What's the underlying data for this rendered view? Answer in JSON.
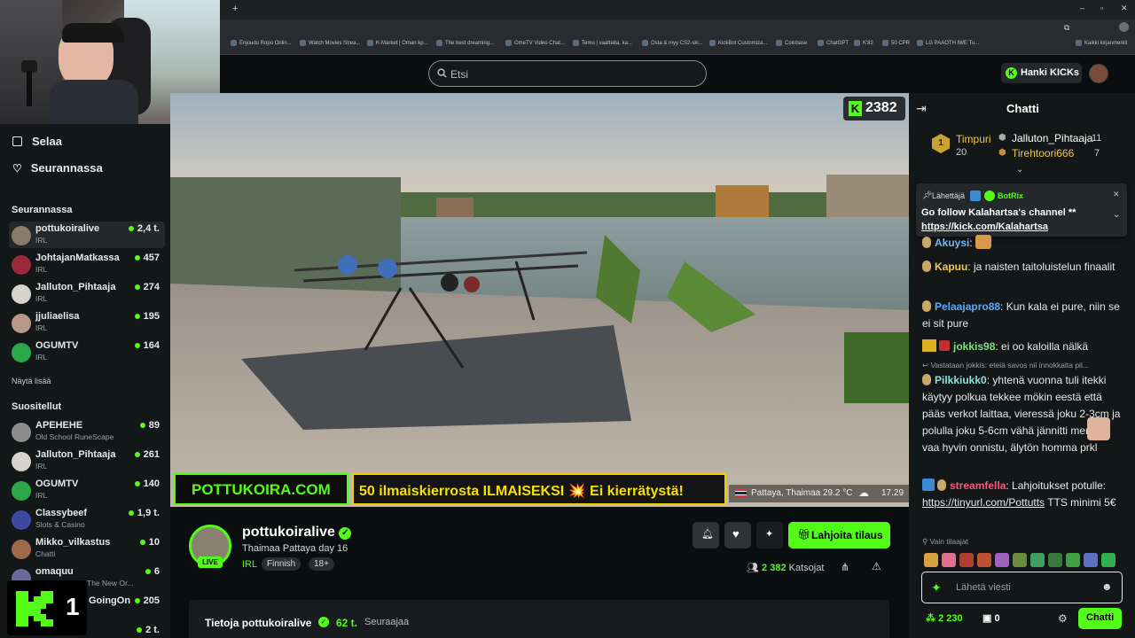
{
  "browser": {
    "bookmarks": [
      "Enjoudu Ropo Onlin...",
      "Watch Movies Strea...",
      "K-Market | Oman kp...",
      "The best dreaming...",
      "OmeTV Video Chat...",
      "Temu | vaatteita, ka...",
      "Osta & myy CS2-ski...",
      "KickBot Customiza...",
      "Coinbase",
      "ChatGPT",
      "K'82",
      "50 CPR",
      "LG PAAOTH IWE Tu...",
      "Kaikki kirjanmerkit"
    ]
  },
  "header": {
    "search_placeholder": "Etsi",
    "hanki_label": "Hanki KICKs"
  },
  "sidebar": {
    "nav": [
      {
        "label": "Selaa",
        "icon": "browse-icon"
      },
      {
        "label": "Seurannassa",
        "icon": "heart-icon"
      }
    ],
    "following_header": "Seurannassa",
    "following": [
      {
        "name": "pottukoiralive",
        "category": "IRL",
        "viewers": "2,4 t."
      },
      {
        "name": "JohtajanMatkassa",
        "category": "IRL",
        "viewers": "457"
      },
      {
        "name": "Jalluton_Pihtaaja",
        "category": "IRL",
        "viewers": "274"
      },
      {
        "name": "jjuliaelisa",
        "category": "IRL",
        "viewers": "195"
      },
      {
        "name": "OGUMTV",
        "category": "IRL",
        "viewers": "164"
      }
    ],
    "show_more": "Näytä lisää",
    "recommended_header": "Suositellut",
    "recommended": [
      {
        "name": "APEHEHE",
        "category": "Old School RuneScape",
        "viewers": "89"
      },
      {
        "name": "Jalluton_Pihtaaja",
        "category": "IRL",
        "viewers": "261"
      },
      {
        "name": "OGUMTV",
        "category": "IRL",
        "viewers": "140"
      },
      {
        "name": "Classybeef",
        "category": "Slots & Casino",
        "viewers": "1,9 t."
      },
      {
        "name": "Mikko_vilkastus",
        "category": "Chatti",
        "viewers": "10"
      },
      {
        "name": "omaquu",
        "category": "The New Or...",
        "viewers": "6"
      },
      {
        "name": "GoingOn",
        "category": "",
        "viewers": "205"
      },
      {
        "name": "",
        "category": "",
        "viewers": "2 t."
      }
    ],
    "overlay_number": "1"
  },
  "video": {
    "viewer_badge": "2382",
    "banner_site": "POTTUKOIRA.COM",
    "banner_promo": "50 ilmaiskierrosta ILMAISEKSI 💥 Ei kierrätystä!",
    "location": "Pattaya, Thaimaa",
    "temperature": "29.2 °C",
    "time": "17.29"
  },
  "stream": {
    "channel": "pottukoiralive",
    "live_label": "LIVE",
    "title": "Thaimaa Pattaya day 16",
    "tags": [
      "IRL",
      "Finnish",
      "18+"
    ],
    "gift_sub_label": "Lahjoita tilaus",
    "viewers": "2 382",
    "viewers_suffix": "Katsojat",
    "about_prefix": "Tietoja pottukoiralive",
    "followers": "62 t.",
    "followers_suffix": "Seuraajaa"
  },
  "chat": {
    "title": "Chatti",
    "leaderboard": [
      {
        "rank": "1",
        "name": "Timpuri",
        "count": "20"
      },
      {
        "name": "Jalluton_Pihtaaja",
        "count": "11"
      },
      {
        "name": "Tirehtoori666",
        "count": "7"
      }
    ],
    "pinned": {
      "label": "Lähettäjä",
      "sender": "BotRix",
      "text": "Go follow Kalahartsa's channel **",
      "link": "https://kick.com/Kalahartsa"
    },
    "messages": [
      {
        "user": "Akuysi",
        "text": "",
        "color": "#6fb6f2"
      },
      {
        "user": "Kapuu",
        "text": "ja naisten taitoluistelun finaalit",
        "color": "#f2c94c"
      },
      {
        "user": "Pelaajapro88",
        "text": "Kun kala ei pure, niin se ei sit pure",
        "color": "#5aa9f5"
      },
      {
        "user": "jokkis98",
        "text": "ei oo kaloilla nälkä",
        "color": "#7be37b"
      },
      {
        "user": "Pilkkiukk0",
        "reply": "Vastataan jokkis: eteiä savos nii innokkalta pil...",
        "text": "yhtenä vuonna tuli itekki käytyy polkua tekkee mökin eestä että pääs verkot laittaa, vieressä joku 2-3cm ja polulla joku 5-6cm vähä jännitti mennä vaa hyvin onnistu, älytön homma prkl",
        "color": "#8be0e0"
      },
      {
        "user": "streamfella",
        "text": "Lahjoitukset potulle:",
        "link": "https://tinyurl.com/Pottutts",
        "extra": "TTS minimi 5€",
        "color": "#f25a7a"
      }
    ],
    "subs_only": "Vain tilaajat",
    "input_placeholder": "Lähetä viesti",
    "points": "2 230",
    "kicks": "0",
    "send_label": "Chatti"
  },
  "colors": {
    "accent": "#53fc18",
    "bg": "#0b0e0f",
    "panel": "#141718"
  }
}
